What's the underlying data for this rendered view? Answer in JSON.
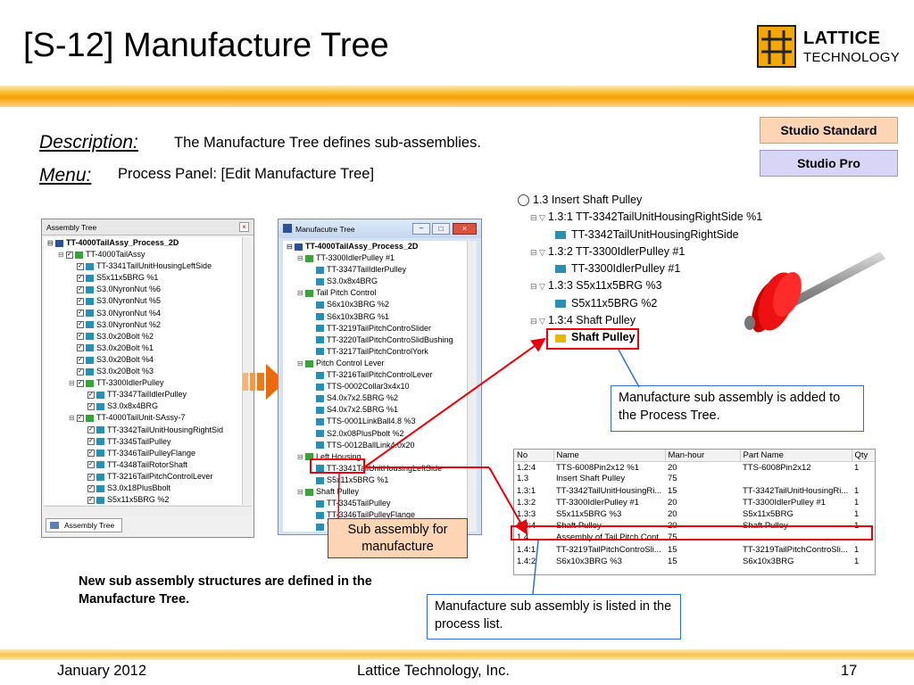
{
  "header": {
    "title": "[S-12] Manufacture Tree",
    "logo_line1": "LATTICE",
    "logo_line2": "TECHNOLOGY"
  },
  "badges": {
    "standard": "Studio Standard",
    "pro": "Studio Pro"
  },
  "info": {
    "description_label": "Description:",
    "description_text": "The Manufacture Tree defines sub-assemblies.",
    "menu_label": "Menu:",
    "menu_text": "Process Panel: [Edit Manufacture Tree]"
  },
  "assembly_window": {
    "title": "Assembly Tree",
    "tab": "Assembly Tree",
    "items": [
      "TT-4000TailAssy_Process_2D",
      "TT-4000TailAssy",
      "TT-3341TailUnitHousingLeftSide",
      "S5x11x5BRG %1",
      "S3.0NyronNut %6",
      "S3.0NyronNut %5",
      "S3.0NyronNut %4",
      "S3.0NyronNut %2",
      "S3.0x20Bolt %2",
      "S3.0x20Bolt %1",
      "S3.0x20Bolt %4",
      "S3.0x20Bolt %3",
      "TT-3300IdlerPulley",
      "TT-3347TailIdlerPulley",
      "S3.0x8x4BRG",
      "TT-4000TailUnit-SAssy-7",
      "TT-3342TailUnitHousingRightSid",
      "TT-3345TailPulley",
      "TT-3346TailPulleyFlange",
      "TT-4348TailRotorShaft",
      "TT-3216TailPitchControlLever",
      "S3.0x18PlusBbolt",
      "S5x11x5BRG %2"
    ]
  },
  "manufacture_window": {
    "title": "Manufacutre Tree",
    "items": [
      "TT-4000TailAssy_Process_2D",
      "TT-3300IdlerPulley #1",
      "TT-3347TailIdlerPulley",
      "S3.0x8x4BRG",
      "Tail Pitch Control",
      "S6x10x3BRG %2",
      "S6x10x3BRG %1",
      "TT-3219TailPitchControSlider",
      "TT-3220TailPitchControSlidBushing",
      "TT-3217TailPitchControlYork",
      "Pitch Control Lever",
      "TT-3216TailPitchControlLever",
      "TTS-0002Collar3x4x10",
      "S4.0x7x2.5BRG %2",
      "S4.0x7x2.5BRG %1",
      "TTS-0001LinkBall4.8 %3",
      "S2.0x08PlusPbolt %2",
      "TTS-0012BallLink4.0x20",
      "Left Housing",
      "TT-3341TailUnitHousingLeftSide",
      "S5x11x5BRG %1",
      "Shaft Pulley",
      "TT-3345TailPulley",
      "TT-3346TailPulleyFlange",
      "TT-4348TailRotorShaft",
      "TTS-...x12"
    ]
  },
  "process_tree": {
    "items": [
      "1.3 Insert Shaft Pulley",
      "1.3:1 TT-3342TailUnitHousingRightSide %1",
      "TT-3342TailUnitHousingRightSide",
      "1.3:2 TT-3300IdlerPulley #1",
      "TT-3300IdlerPulley #1",
      "1.3:3 S5x11x5BRG %3",
      "S5x11x5BRG %2",
      "1.3:4 Shaft Pulley",
      "Shaft Pulley"
    ]
  },
  "callouts": {
    "process_tree": "Manufacture sub assembly is added to the Process Tree.",
    "sub_assembly": "Sub assembly for manufacture",
    "process_list": "Manufacture sub assembly is listed in the process list."
  },
  "note": "New sub assembly structures are defined in the Manufacture Tree.",
  "process_table": {
    "headers": [
      "No",
      "Name",
      "Man-hour",
      "Part Name",
      "Qty"
    ],
    "rows": [
      [
        "1.2:4",
        "TTS-6008Pin2x12 %1",
        "20",
        "TTS-6008Pin2x12",
        "1"
      ],
      [
        "1.3",
        "Insert Shaft Pulley",
        "75",
        "",
        ""
      ],
      [
        "1.3:1",
        "TT-3342TailUnitHousingRi...",
        "15",
        "TT-3342TailUnitHousingRi...",
        "1"
      ],
      [
        "1.3:2",
        "TT-3300IdlerPulley #1",
        "20",
        "TT-3300IdlerPulley #1",
        "1"
      ],
      [
        "1.3:3",
        "S5x11x5BRG %3",
        "20",
        "S5x11x5BRG",
        "1"
      ],
      [
        "1.3:4",
        "Shaft Pulley",
        "20",
        "Shaft Pulley",
        "1"
      ],
      [
        "1.4",
        "Assembly of Tail Pitch Cont...",
        "75",
        "",
        ""
      ],
      [
        "1.4:1",
        "TT-3219TailPitchControSli...",
        "15",
        "TT-3219TailPitchControSli...",
        "1"
      ],
      [
        "1.4:2",
        "S6x10x3BRG %3",
        "15",
        "S6x10x3BRG",
        "1"
      ]
    ]
  },
  "footer": {
    "date": "January 2012",
    "company": "Lattice Technology, Inc.",
    "page": "17"
  },
  "colors": {
    "accent": "#F5A000",
    "highlight": "#E8000B",
    "callout_border": "#2F6FD1"
  }
}
